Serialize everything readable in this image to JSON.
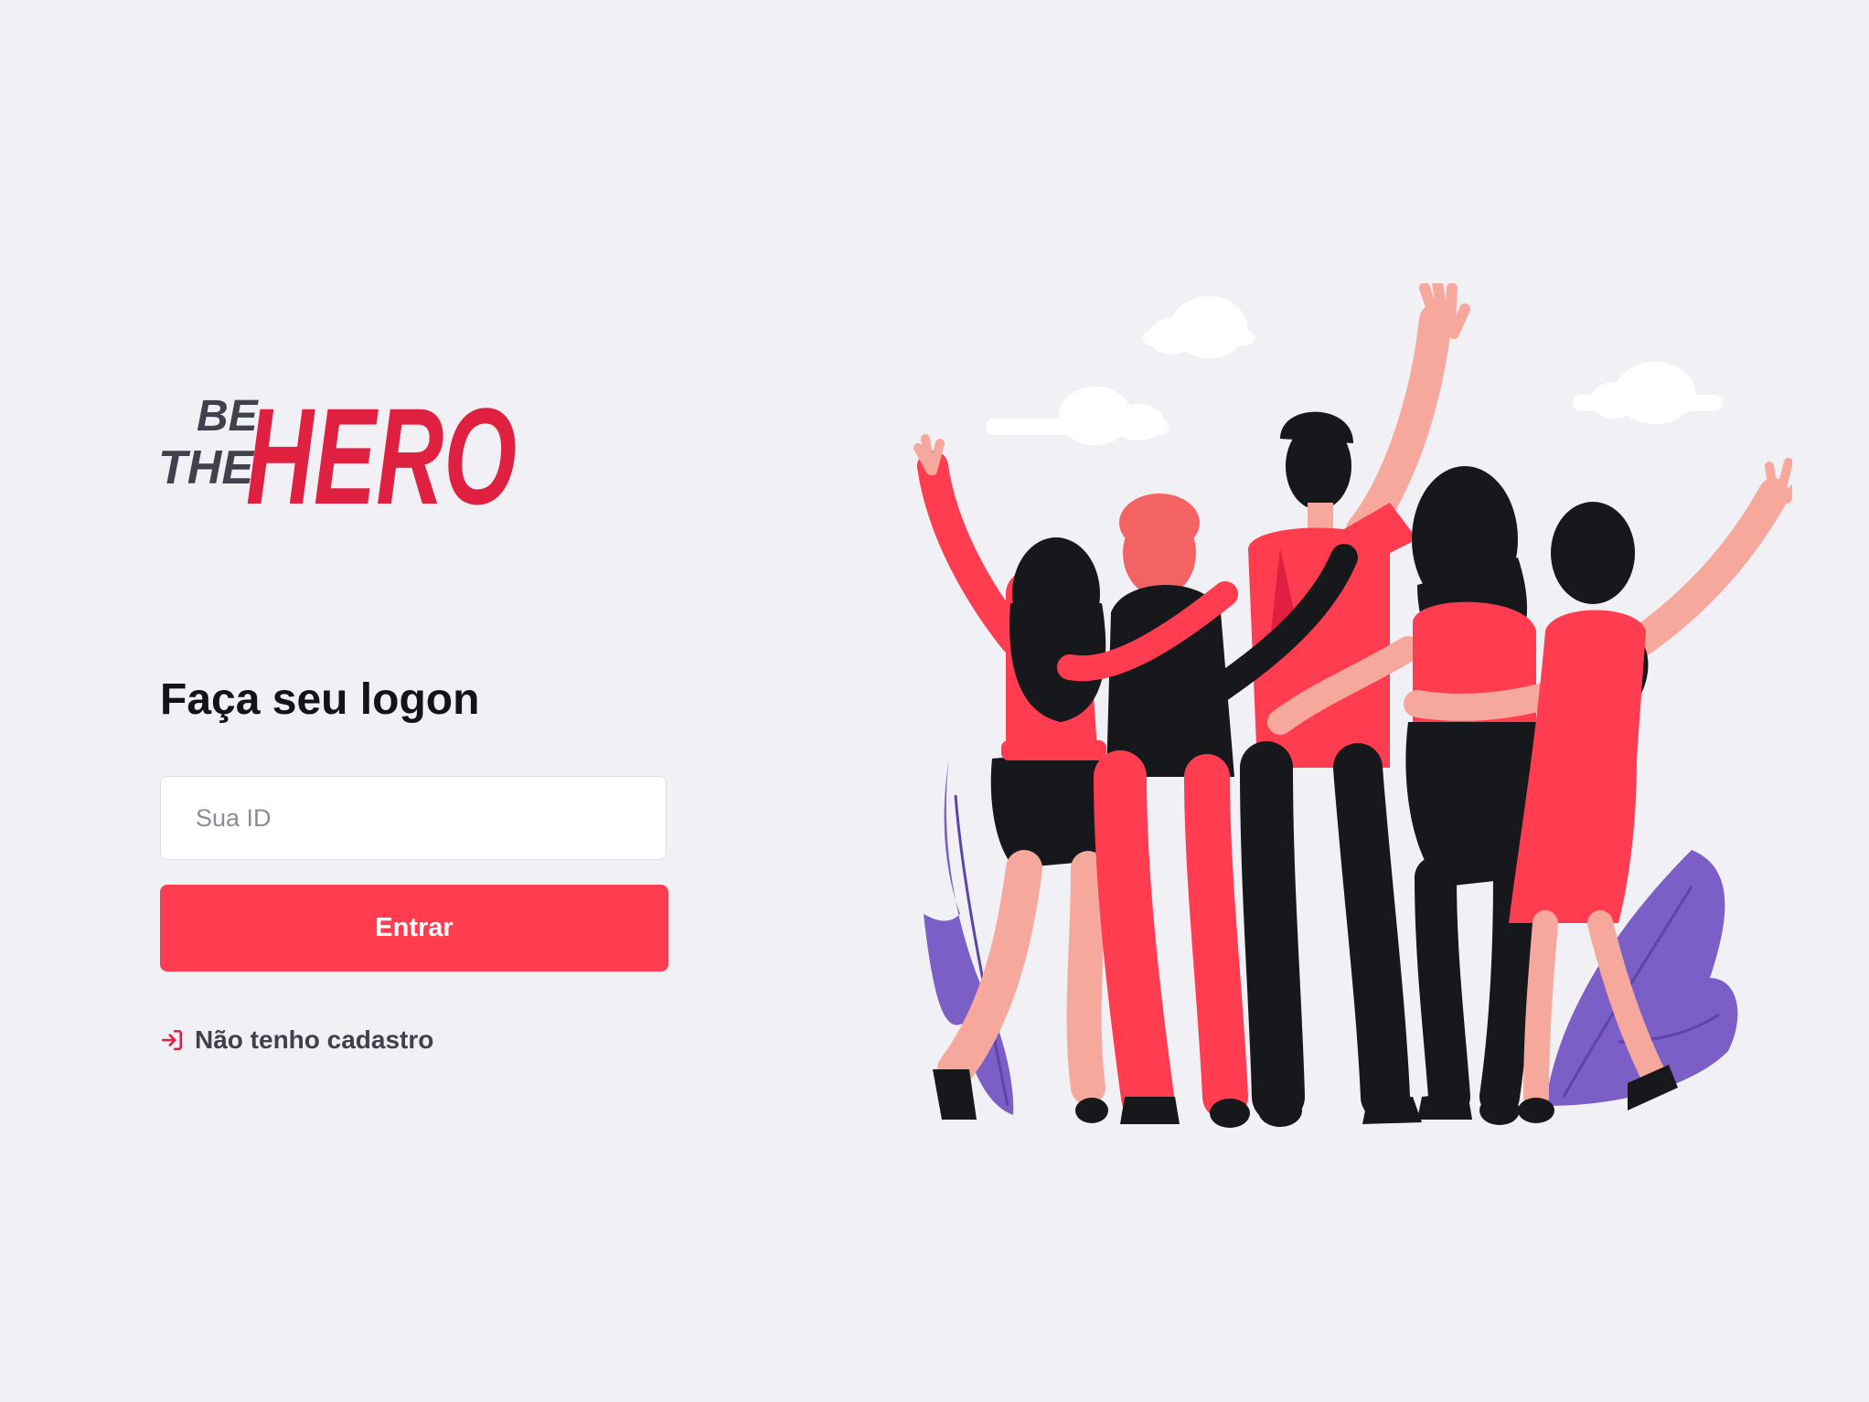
{
  "brand": {
    "tagline": "BE THE",
    "name": "HERO",
    "primary_color": "#FF3C50",
    "logo_red": "#E02041",
    "text_dark": "#41414D",
    "background": "#F0F0F5"
  },
  "logon": {
    "title": "Faça seu logon",
    "id_input": {
      "placeholder": "Sua ID",
      "value": ""
    },
    "submit_label": "Entrar",
    "register_link": {
      "label": "Não tenho cadastro",
      "icon": "log-in-icon"
    }
  },
  "illustration": {
    "subject": "people-group-illustration",
    "accent_colors": [
      "#FF3C50",
      "#7B5FC7",
      "#17181C",
      "#F7A89C"
    ]
  }
}
